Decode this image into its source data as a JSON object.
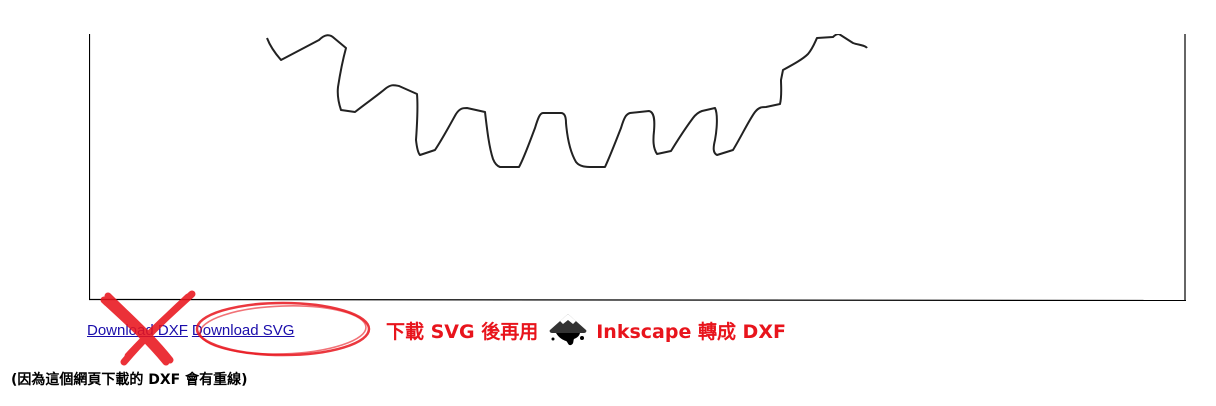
{
  "links": {
    "download_dxf": "Download DXF",
    "download_svg": "Download SVG"
  },
  "annotation": {
    "part1": "下載 SVG 後再用",
    "logo_icon": "inkscape-logo-icon",
    "part2": "Inkscape 轉成 DXF",
    "color": "#e8141c"
  },
  "footnote": "(因為這個網頁下載的 DXF 會有重線)",
  "colors": {
    "link": "#1a0dab",
    "annotation_red": "#e8141c",
    "gear_stroke": "#222222"
  }
}
